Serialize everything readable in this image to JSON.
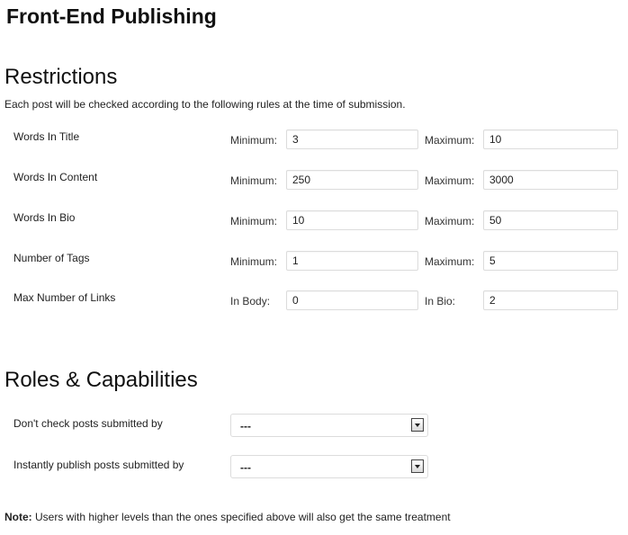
{
  "page": {
    "title": "Front-End Publishing"
  },
  "restrictions": {
    "title": "Restrictions",
    "description": "Each post will be checked according to the following rules at the time of submission.",
    "rows": [
      {
        "label": "Words In Title",
        "min_label": "Minimum:",
        "min_value": "3",
        "max_label": "Maximum:",
        "max_value": "10"
      },
      {
        "label": "Words In Content",
        "min_label": "Minimum:",
        "min_value": "250",
        "max_label": "Maximum:",
        "max_value": "3000"
      },
      {
        "label": "Words In Bio",
        "min_label": "Minimum:",
        "min_value": "10",
        "max_label": "Maximum:",
        "max_value": "50"
      },
      {
        "label": "Number of Tags",
        "min_label": "Minimum:",
        "min_value": "1",
        "max_label": "Maximum:",
        "max_value": "5"
      },
      {
        "label": "Max Number of Links",
        "min_label": "In Body:",
        "min_value": "0",
        "max_label": "In Bio:",
        "max_value": "2"
      }
    ]
  },
  "roles": {
    "title": "Roles & Capabilities",
    "rows": [
      {
        "label": "Don't check posts submitted by",
        "selected": "---"
      },
      {
        "label": "Instantly publish posts submitted by",
        "selected": "---"
      }
    ]
  },
  "note": {
    "prefix": "Note:",
    "text": " Users with higher levels than the ones specified above will also get the same treatment"
  }
}
